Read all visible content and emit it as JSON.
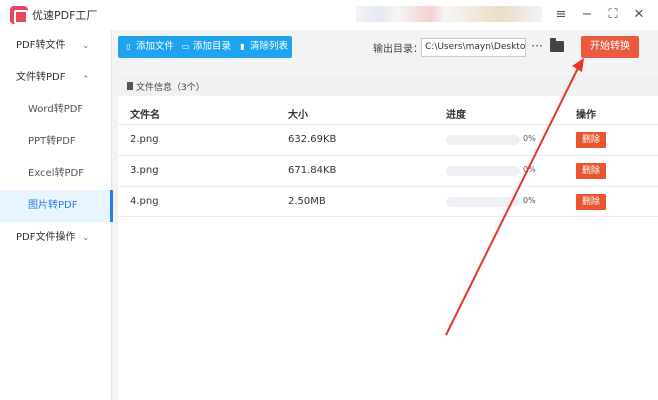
{
  "app": {
    "title": "优速PDF工厂"
  },
  "window_controls": {
    "menu": "≡",
    "minimize": "−",
    "maximize": "⛶",
    "close": "✕"
  },
  "sidebar": {
    "items": [
      {
        "label": "PDF转文件",
        "chevron": "⌄"
      },
      {
        "label": "文件转PDF",
        "chevron": "⌃"
      },
      {
        "label": "Word转PDF"
      },
      {
        "label": "PPT转PDF"
      },
      {
        "label": "Excel转PDF"
      },
      {
        "label": "图片转PDF"
      },
      {
        "label": "PDF文件操作",
        "chevron": "⌄"
      }
    ],
    "active": "图片转PDF"
  },
  "toolbar": {
    "add_file": "添加文件",
    "add_dir": "添加目录",
    "clear": "清除列表",
    "output_label": "输出目录：",
    "output_path": "C:\\Users\\mayn\\Desktop",
    "more": "···",
    "start": "开始转换"
  },
  "file_panel": {
    "header": "文件信息（3个）",
    "columns": [
      "文件名",
      "大小",
      "进度",
      "操作"
    ],
    "rows": [
      {
        "name": "2.png",
        "size": "632.69KB",
        "progress": 0,
        "progress_label": "0%",
        "action": "删除"
      },
      {
        "name": "3.png",
        "size": "671.84KB",
        "progress": 0,
        "progress_label": "0%",
        "action": "删除"
      },
      {
        "name": "4.png",
        "size": "2.50MB",
        "progress": 0,
        "progress_label": "0%",
        "action": "删除"
      }
    ]
  },
  "colors": {
    "accent_blue": "#1fa3f0",
    "start_orange": "#eb5a3f",
    "delete_red": "#e8552e",
    "arrow_red": "#e8352a"
  }
}
